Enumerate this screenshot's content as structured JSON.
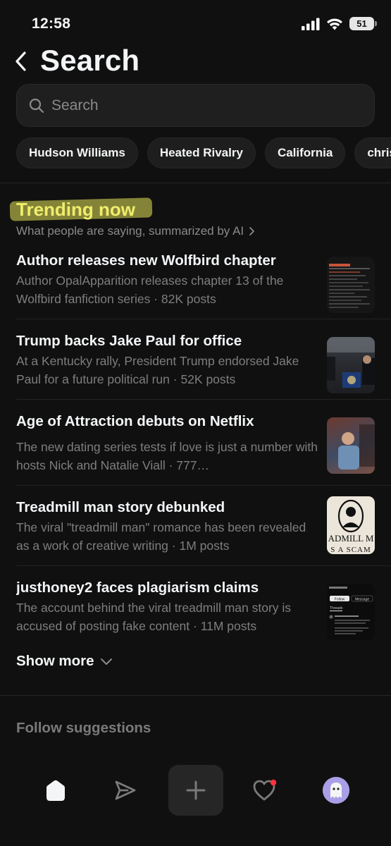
{
  "status": {
    "time": "12:58",
    "battery": "51"
  },
  "header": {
    "title": "Search"
  },
  "search": {
    "placeholder": "Search",
    "value": ""
  },
  "chips": [
    "Hudson Williams",
    "Heated Rivalry",
    "California",
    "chris"
  ],
  "trending": {
    "heading": "Trending now",
    "subtitle": "What people are saying, summarized by AI",
    "items": [
      {
        "title": "Author releases new Wolfbird chapter",
        "description": "Author OpalApparition releases chapter 13 of the Wolfbird fanfiction series · 82K posts"
      },
      {
        "title": "Trump backs Jake Paul for office",
        "description": "At a Kentucky rally, President Trump endorsed Jake Paul for a future political run · 52K posts"
      },
      {
        "title": "Age of Attraction debuts on Netflix",
        "description": "The new dating series tests if love is just a number with hosts Nick and Natalie Viall · 777…"
      },
      {
        "title": "Treadmill man story debunked",
        "description": "The viral \"treadmill man\" romance has been revealed as a work of creative writing · 1M posts"
      },
      {
        "title": "justhoney2 faces plagiarism claims",
        "description": "The account behind the viral treadmill man story is accused of posting fake content · 11M posts"
      }
    ],
    "thumb4_text": [
      "ADMILL M",
      "S A SCAM"
    ],
    "thumb5_text": {
      "follow": "Follow",
      "message": "Message",
      "tab": "Threads"
    },
    "show_more": "Show more"
  },
  "follow_suggestions": {
    "label": "Follow suggestions"
  },
  "colors": {
    "background": "#101010",
    "highlight": "#e4e35a",
    "notification": "#ff3040",
    "avatar": "#a99fe6"
  },
  "nav": {
    "items": [
      "home-icon",
      "send-icon",
      "plus-icon",
      "heart-icon",
      "profile-avatar"
    ]
  }
}
